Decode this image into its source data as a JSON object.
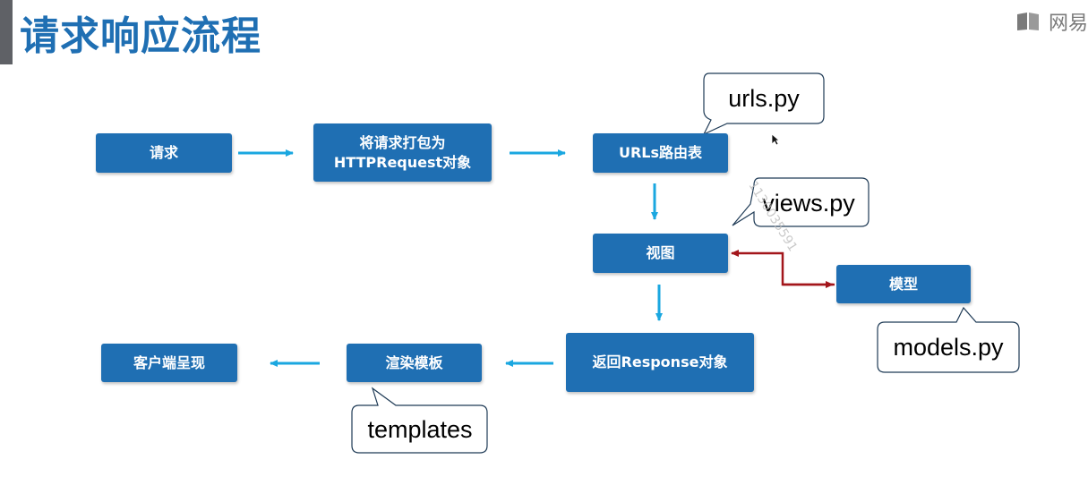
{
  "title": "请求响应流程",
  "logo_text": "网易",
  "watermark": "1130035591",
  "nodes": {
    "request": "请求",
    "wrap_line1": "将请求打包为",
    "wrap_line2": "HTTPRequest对象",
    "urls": "URLs路由表",
    "view": "视图",
    "model": "模型",
    "response": "返回Response对象",
    "render": "渲染模板",
    "client": "客户端呈现"
  },
  "callouts": {
    "urls_py": "urls.py",
    "views_py": "views.py",
    "models_py": "models.py",
    "templates": "templates"
  },
  "colors": {
    "box": "#1f6fb3",
    "arrow": "#1aa7e0",
    "model_link": "#a3161b",
    "title": "#1f6fb3"
  }
}
